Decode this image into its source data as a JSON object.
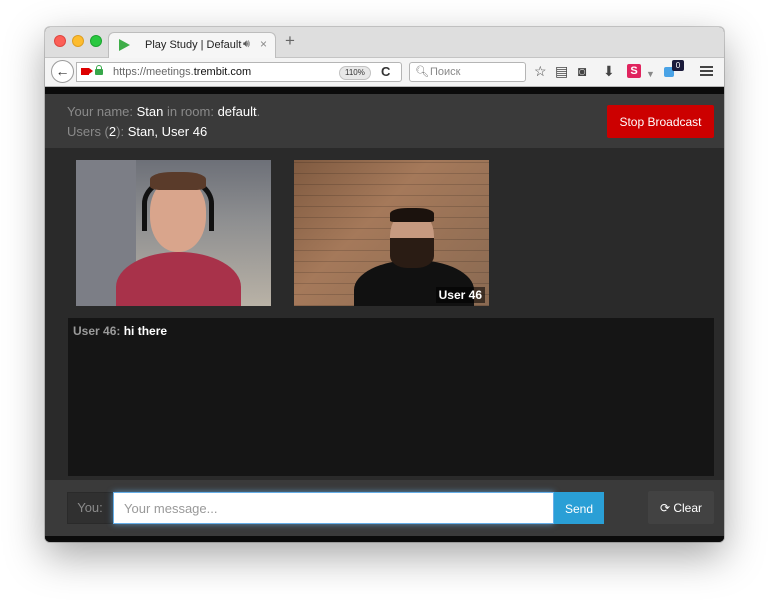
{
  "browser": {
    "tab_title": "Play Study | Default",
    "tab_close": "×",
    "new_tab": "+",
    "back": "←",
    "url_prefix": "https://meetings.",
    "url_domain": "trembit.com",
    "zoom": "110%",
    "reload": "C",
    "search_placeholder": "Поиск",
    "extension_count": "0",
    "s_badge": "S"
  },
  "header": {
    "name_label": "Your name: ",
    "name_value": "Stan",
    "room_label": " in room: ",
    "room_value": "default",
    "room_end": ".",
    "users_label": "Users (",
    "users_count": "2",
    "users_paren": "): ",
    "users_list": "Stan, User 46",
    "stop_button": "Stop Broadcast"
  },
  "videos": [
    {
      "label": ""
    },
    {
      "label": "User 46"
    }
  ],
  "chat": {
    "messages": [
      {
        "sender": "User 46:",
        "text": " hi there"
      }
    ]
  },
  "composer": {
    "you_label": "You:",
    "placeholder": "Your message...",
    "value": "",
    "send_button": "Send",
    "clear_button": "Clear"
  },
  "colors": {
    "stop_button": "#cc0000",
    "send_button": "#2a9fd6",
    "input_focus": "#66afe9"
  }
}
